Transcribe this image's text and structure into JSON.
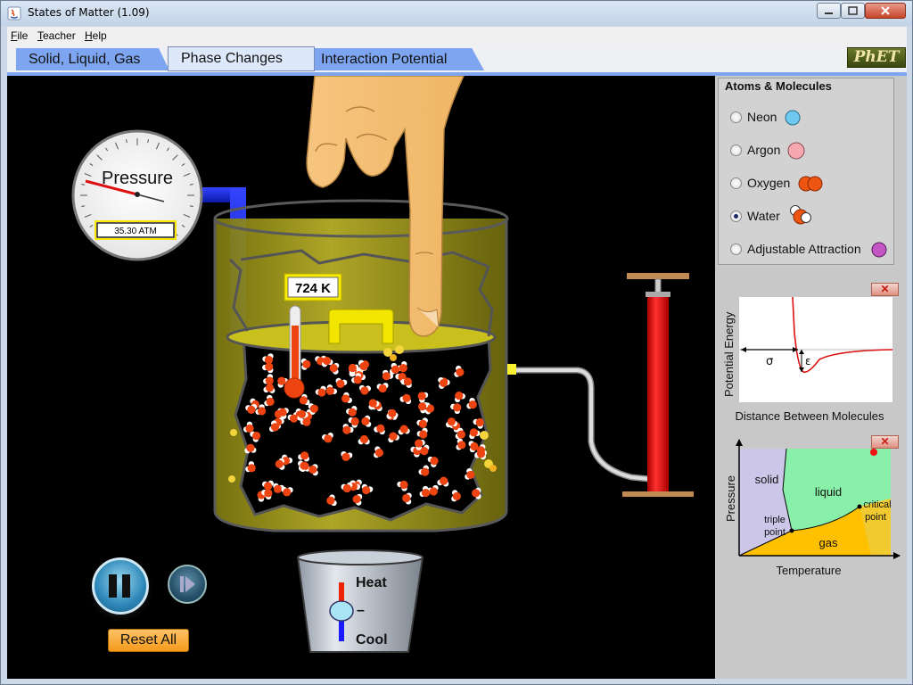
{
  "window": {
    "title": "States of Matter (1.09)",
    "minimize_symbol": "─",
    "maximize_symbol": "□",
    "close_symbol": "✕"
  },
  "menu": [
    {
      "key": "F",
      "rest": "ile"
    },
    {
      "key": "T",
      "rest": "eacher"
    },
    {
      "key": "H",
      "rest": "elp"
    }
  ],
  "tabs": [
    {
      "label": "Solid, Liquid, Gas",
      "selected": false
    },
    {
      "label": "Phase Changes",
      "selected": true
    },
    {
      "label": "Interaction Potential",
      "selected": false
    }
  ],
  "logo_text": "PhET",
  "pressure_gauge": {
    "title": "Pressure",
    "readout": "35.30 ATM"
  },
  "thermometer": {
    "readout": "724 K"
  },
  "heat_cool": {
    "heat_label": "Heat",
    "cool_label": "Cool",
    "slider_mark": "–"
  },
  "controls": {
    "pause_icon": "pause-icon",
    "step_icon": "step-icon",
    "reset_label": "Reset All"
  },
  "atoms_panel": {
    "title": "Atoms & Molecules",
    "options": [
      {
        "label": "Neon",
        "selected": false,
        "color": "#6ec8f0"
      },
      {
        "label": "Argon",
        "selected": false,
        "color": "#f5a8b0"
      },
      {
        "label": "Oxygen",
        "selected": false,
        "color": "#ee5511"
      },
      {
        "label": "Water",
        "selected": true,
        "color": "#ee5511"
      },
      {
        "label": "Adjustable Attraction",
        "selected": false,
        "color": "#c455c4"
      }
    ]
  },
  "potential_graph": {
    "ylabel": "Potential Energy",
    "xlabel": "Distance Between Molecules",
    "sigma_label": "σ",
    "epsilon_label": "ε",
    "close_symbol": "✕"
  },
  "phase_diagram": {
    "ylabel": "Pressure",
    "xlabel": "Temperature",
    "regions": {
      "solid": "solid",
      "liquid": "liquid",
      "gas": "gas"
    },
    "points": {
      "triple_1": "triple",
      "triple_2": "point",
      "critical_1": "critical",
      "critical_2": "point"
    },
    "close_symbol": "✕"
  },
  "colors": {
    "canvas_bg": "#000000",
    "container_fill": "#a8a01a",
    "molecule_oxygen": "#ee4411",
    "molecule_hydrogen": "#ffffff",
    "reset_button": "#f8a531",
    "tab_active": "#dde8fb",
    "tab_inactive": "#7ea5f0"
  }
}
